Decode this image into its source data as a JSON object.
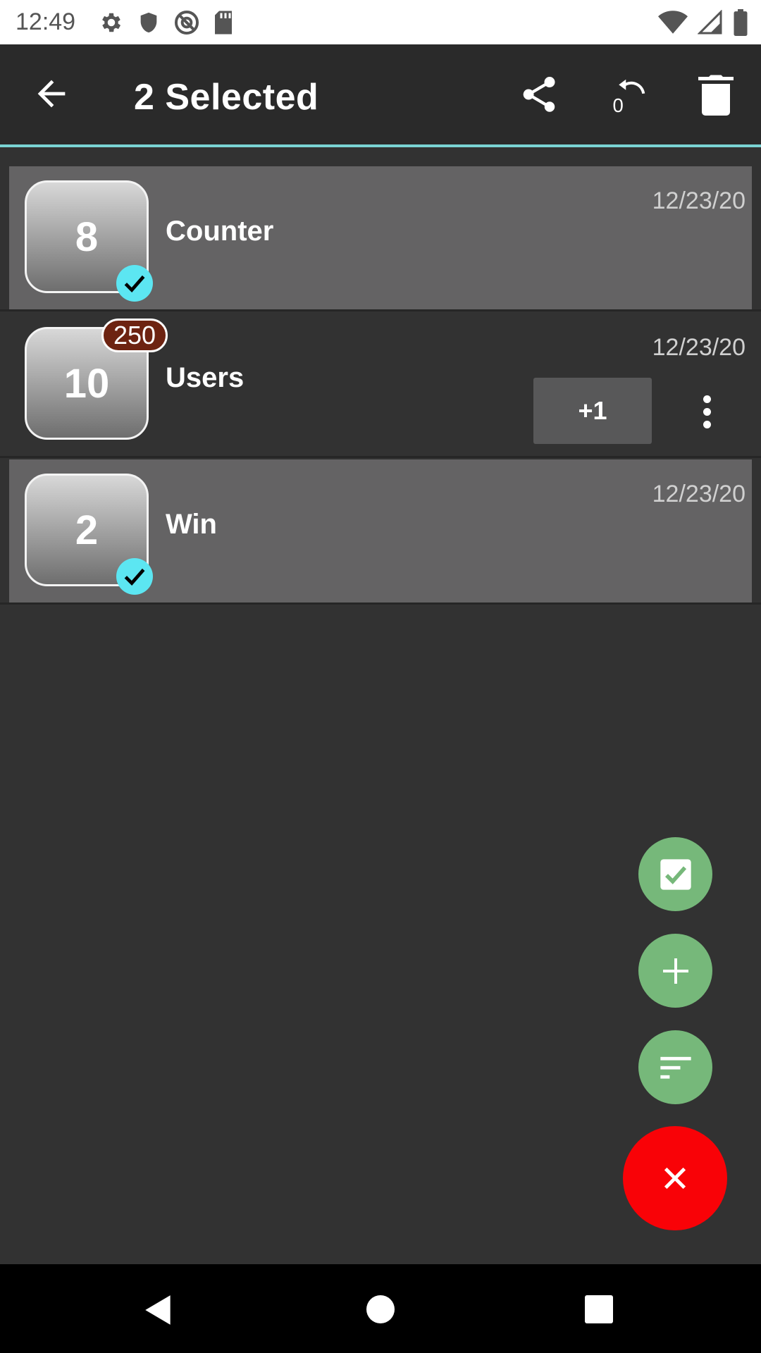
{
  "status_bar": {
    "time": "12:49",
    "left_icons": [
      "gear-icon",
      "shield-icon",
      "at-sign-icon",
      "sd-card-icon"
    ],
    "right_icons": [
      "wifi-icon",
      "signal-icon",
      "battery-icon"
    ]
  },
  "app_bar": {
    "title": "2 Selected",
    "accent_color": "#7ad3d3",
    "actions": [
      "share-icon",
      "reset-icon",
      "delete-icon"
    ],
    "reset_icon_text": "0"
  },
  "counters": [
    {
      "value": "8",
      "name": "Counter",
      "date": "12/23/20",
      "selected": true
    },
    {
      "value": "10",
      "name": "Users",
      "date": "12/23/20",
      "selected": false,
      "goal": "250",
      "increment_label": "+1"
    },
    {
      "value": "2",
      "name": "Win",
      "date": "12/23/20",
      "selected": true
    }
  ],
  "fabs": {
    "select_all": "checkbox-icon",
    "add": "plus-icon",
    "sort": "sort-icon",
    "close": "close-icon",
    "fab_color": "#76b87a",
    "close_color": "#f90207"
  },
  "colors": {
    "check_badge": "#5ce6f2",
    "goal_badge": "#6d2311",
    "selected_row": "#646364",
    "background": "#323232"
  }
}
